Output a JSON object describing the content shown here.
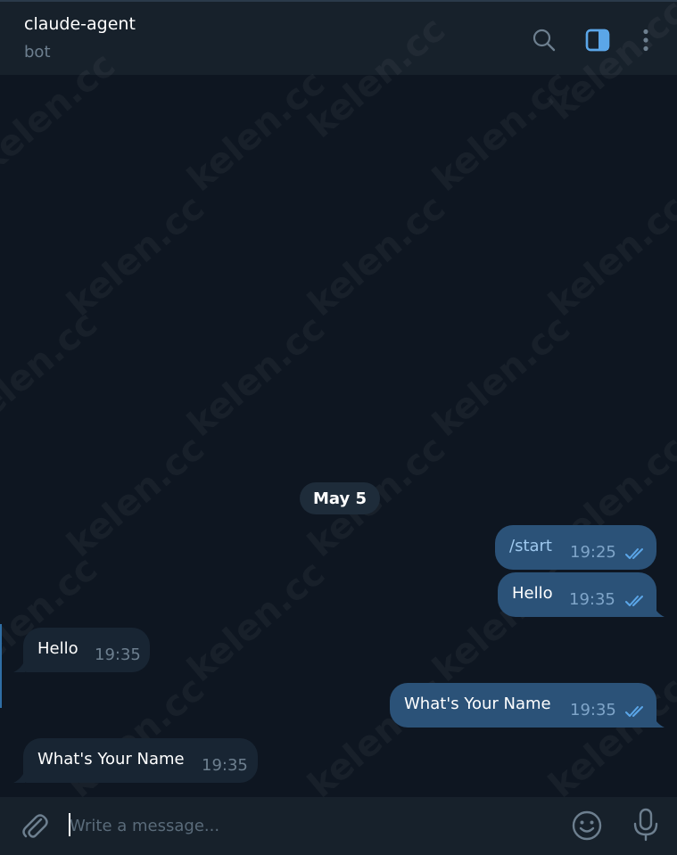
{
  "header": {
    "title": "claude-agent",
    "subtitle": "bot"
  },
  "icons": {
    "search": "search-icon",
    "sidebar": "sidebar-toggle-icon",
    "more": "more-vertical-icon",
    "attach": "paperclip-icon",
    "emoji": "emoji-icon",
    "mic": "microphone-icon"
  },
  "watermark": "kelen.cc",
  "date_separator": "May 5",
  "messages": [
    {
      "direction": "out",
      "text": "/start",
      "time": "19:25",
      "read": true
    },
    {
      "direction": "out",
      "text": "Hello",
      "time": "19:35",
      "read": true
    },
    {
      "direction": "in",
      "text": "Hello",
      "time": "19:35"
    },
    {
      "direction": "out",
      "text": "What's Your Name",
      "time": "19:35",
      "read": true
    },
    {
      "direction": "in",
      "text": "What's Your Name",
      "time": "19:35"
    }
  ],
  "composer": {
    "placeholder": "Write a message..."
  },
  "colors": {
    "background": "#0e1621",
    "header": "#17212b",
    "outgoing_bubble": "#2b5278",
    "incoming_bubble": "#182533",
    "accent": "#5ba6e8"
  }
}
